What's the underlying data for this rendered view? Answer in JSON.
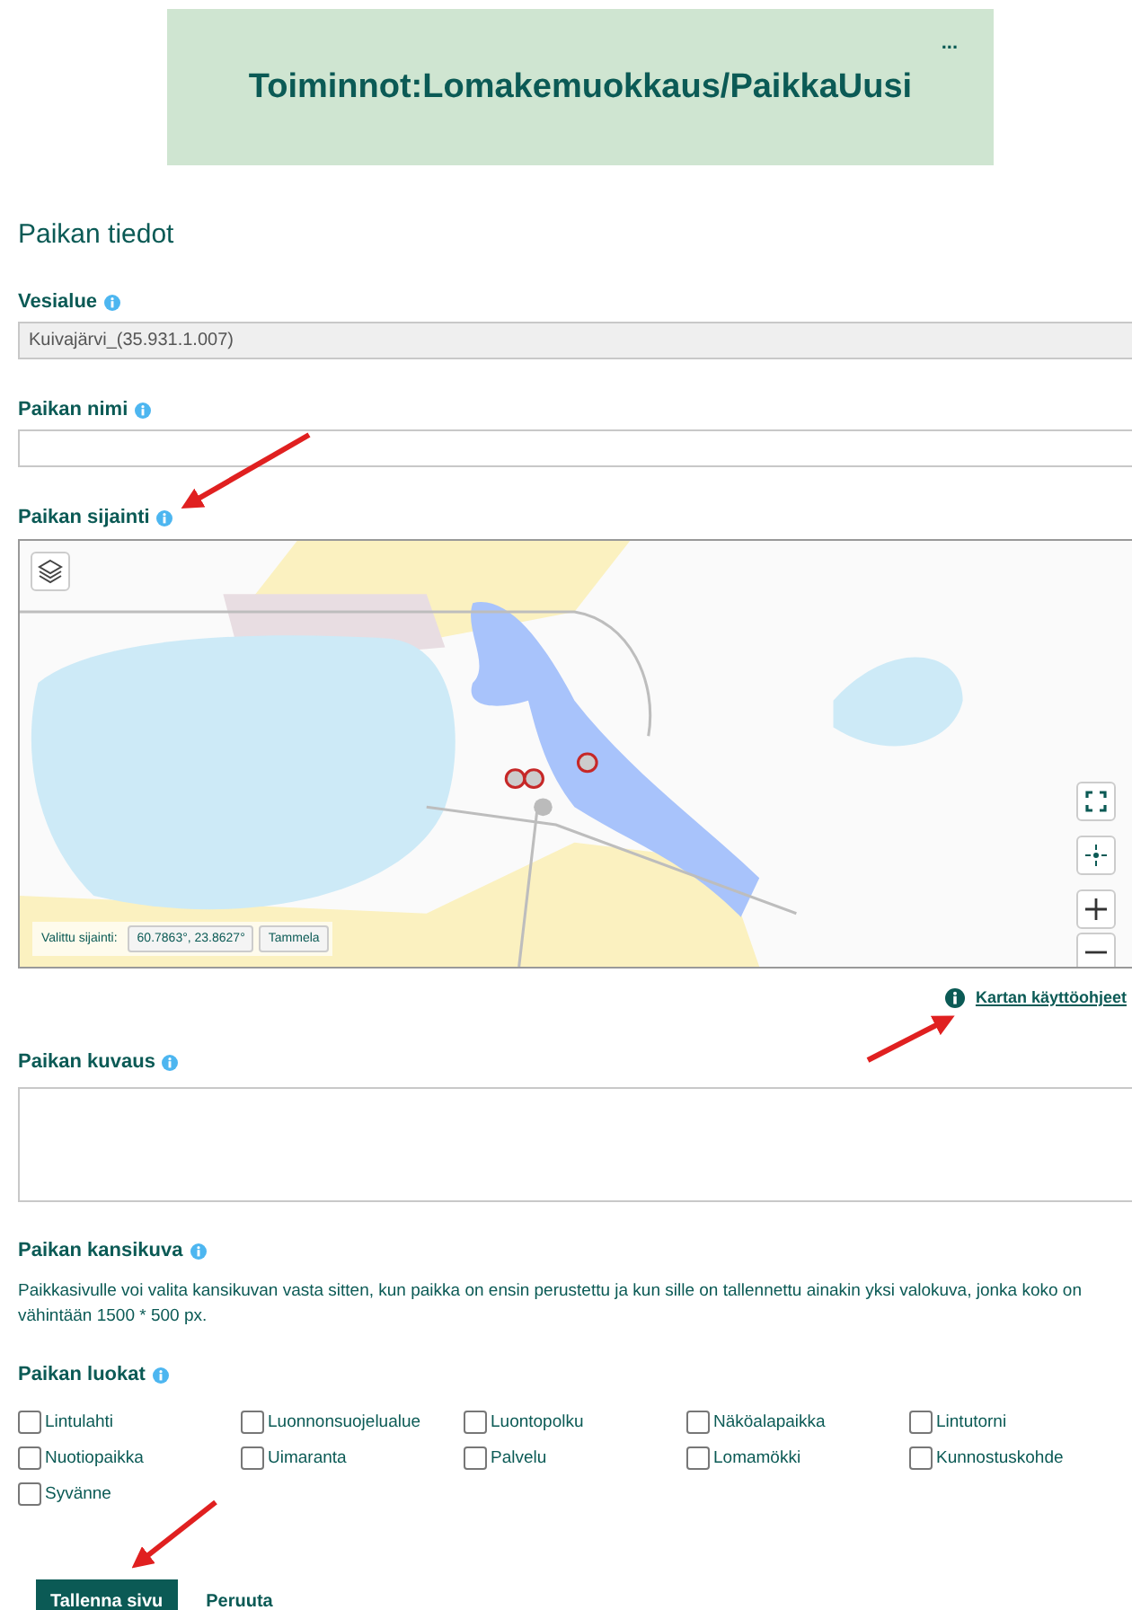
{
  "header": {
    "title": "Toiminnot:Lomakemuokkaus/PaikkaUusi",
    "menu": "..."
  },
  "section_title": "Paikan tiedot",
  "fields": [
    {
      "label": "Vesialue",
      "value": "Kuivajärvi_(35.931.1.007)",
      "readonly": true
    },
    {
      "label": "Paikan nimi",
      "readonly": false
    }
  ],
  "map": {
    "label": "Paikan sijainti",
    "selected_location_label": "Valittu sijainti:",
    "coordinates": "60.7863°, 23.8627°",
    "municipality": "Tammela",
    "help_link": "Kartan käyttöohjeet"
  },
  "description": {
    "label": "Paikan kuvaus"
  },
  "cover_image": {
    "label": "Paikan kansikuva",
    "text": "Paikkasivulle voi valita kansikuvan vasta sitten, kun paikka on ensin perustettu ja kun sille on tallennettu ainakin yksi valokuva, jonka koko on vähintään 1500 * 500 px."
  },
  "categories": {
    "label": "Paikan luokat",
    "items": [
      {
        "label": "Lintulahti",
        "checked": false
      },
      {
        "label": "Luonnonsuojelualue",
        "checked": false
      },
      {
        "label": "Luontopolku",
        "checked": false
      },
      {
        "label": "Näköalapaikka",
        "checked": false
      },
      {
        "label": "Lintutorni",
        "checked": false
      },
      {
        "label": "Nuotiopaikka",
        "checked": false
      },
      {
        "label": "Uimaranta",
        "checked": false
      },
      {
        "label": "Palvelu",
        "checked": false
      },
      {
        "label": "Lomamökki",
        "checked": false
      },
      {
        "label": "Kunnostuskohde",
        "checked": false
      },
      {
        "label": "Syvänne",
        "checked": false
      }
    ]
  },
  "buttons": {
    "save": "Tallenna sivu",
    "cancel": "Peruuta"
  }
}
